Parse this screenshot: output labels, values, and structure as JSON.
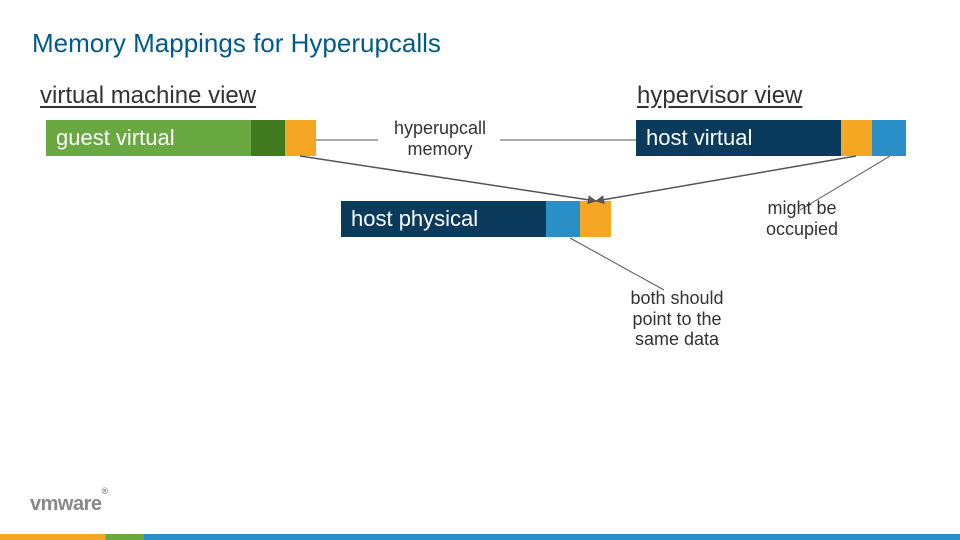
{
  "title": "Memory Mappings for Hyperupcalls",
  "left_header": "virtual machine view",
  "right_header": "hypervisor view",
  "guest_label": "guest virtual",
  "host_virtual_label": "host virtual",
  "host_physical_label": "host physical",
  "center_label_line1": "hyperupcall",
  "center_label_line2": "memory",
  "annot_right_line1": "might be",
  "annot_right_line2": "occupied",
  "annot_bottom_line1": "both should",
  "annot_bottom_line2": "point to the",
  "annot_bottom_line3": "same data",
  "logo_text": "vmware",
  "colors": {
    "green": "#6aa842",
    "dark_green": "#3f7a1f",
    "orange": "#f5a623",
    "blue_dark": "#0a3a5c",
    "blue": "#2a8fc7"
  }
}
